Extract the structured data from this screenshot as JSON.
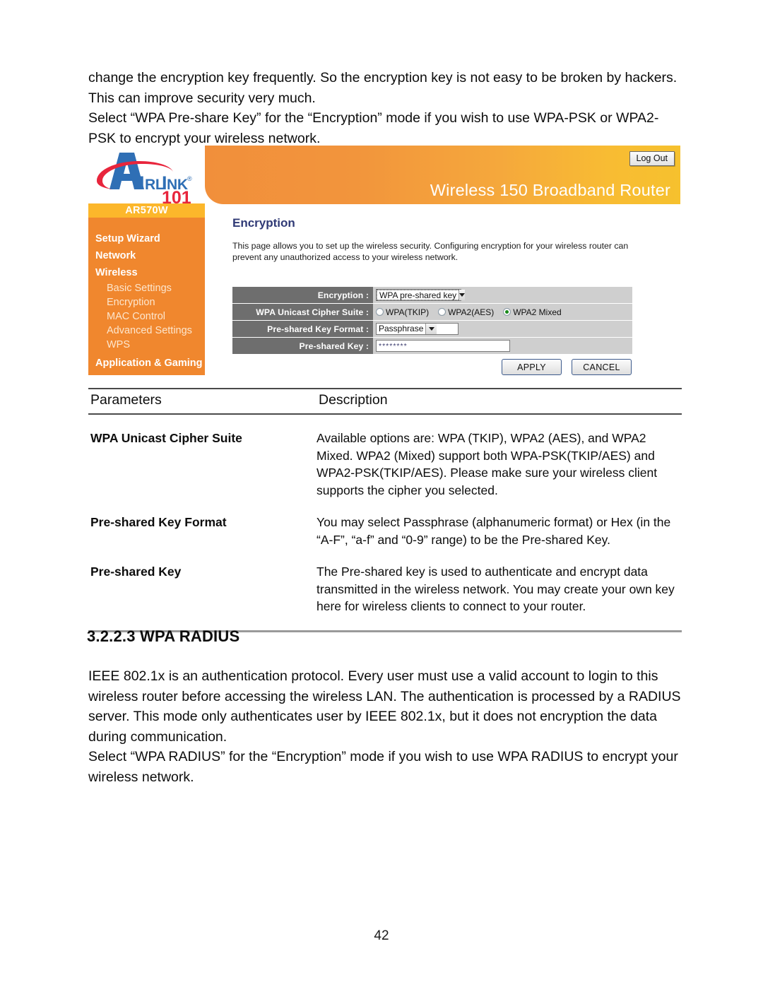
{
  "intro": {
    "paragraph_1": "change the encryption key frequently. So the encryption key is not easy to be broken by hackers. This can improve security very much.",
    "paragraph_2": "Select “WPA Pre-share Key” for the “Encryption” mode if you wish to use WPA-PSK or WPA2-PSK to encrypt your wireless network."
  },
  "router_ui": {
    "brand": {
      "name_a": "A",
      "name_rest": "IRLINK",
      "registered_mark": "®",
      "sub_number": "101"
    },
    "header": {
      "logout_label": "Log Out",
      "title": "Wireless 150 Broadband Router",
      "gradient_start": "#f18f3b",
      "gradient_end": "#f6c12e"
    },
    "sidebar": {
      "model": "AR570W",
      "model_bar_color": "#fcb72b",
      "background_color": "#f0872e",
      "items": [
        {
          "label": "Setup Wizard",
          "level": "top"
        },
        {
          "label": "Network",
          "level": "top"
        },
        {
          "label": "Wireless",
          "level": "top"
        },
        {
          "label": "Basic Settings",
          "level": "sub"
        },
        {
          "label": "Encryption",
          "level": "sub"
        },
        {
          "label": "MAC Control",
          "level": "sub"
        },
        {
          "label": "Advanced Settings",
          "level": "sub"
        },
        {
          "label": "WPS",
          "level": "sub"
        },
        {
          "label": "Application & Gaming",
          "level": "top"
        }
      ]
    },
    "content": {
      "title": "Encryption",
      "title_color": "#303a76",
      "description": "This page allows you to set up the wireless security. Configuring encryption for your wireless router can prevent any unauthorized access to your wireless network."
    },
    "form": {
      "encryption": {
        "label": "Encryption :",
        "value": "WPA pre-shared key"
      },
      "cipher_suite": {
        "label": "WPA Unicast Cipher Suite :",
        "options": [
          {
            "label": "WPA(TKIP)",
            "selected": false
          },
          {
            "label": "WPA2(AES)",
            "selected": false
          },
          {
            "label": "WPA2 Mixed",
            "selected": true
          }
        ],
        "selected_color": "#1a8a1a"
      },
      "key_format": {
        "label": "Pre-shared Key Format :",
        "value": "Passphrase"
      },
      "pre_shared_key": {
        "label": "Pre-shared Key :",
        "value": "********"
      },
      "apply_label": "APPLY",
      "cancel_label": "CANCEL"
    }
  },
  "param_table": {
    "headers": {
      "col1": "Parameters",
      "col2": "Description"
    },
    "rows": [
      {
        "parameter": "WPA Unicast Cipher Suite",
        "description": "Available options are: WPA (TKIP), WPA2 (AES), and WPA2 Mixed. WPA2 (Mixed) support both WPA-PSK(TKIP/AES) and WPA2-PSK(TKIP/AES). Please make sure your wireless client supports the cipher you selected."
      },
      {
        "parameter": "Pre-shared Key Format",
        "description": "You may select Passphrase (alphanumeric format) or Hex (in the “A-F”, “a-f” and “0-9” range) to be the Pre-shared Key."
      },
      {
        "parameter": "Pre-shared Key",
        "description": "The Pre-shared key is used to authenticate and encrypt data transmitted in the wireless network. You may create your own key here for wireless clients to connect to your router."
      }
    ]
  },
  "section": {
    "heading": "3.2.2.3 WPA RADIUS",
    "paragraph_1": "IEEE 802.1x is an authentication protocol. Every user must use a valid account to login to this wireless router before accessing the wireless LAN. The authentication is processed by a RADIUS server. This mode only authenticates user by IEEE 802.1x, but it does not encryption the data during communication.",
    "paragraph_2": "Select “WPA RADIUS” for the “Encryption” mode if you wish to use WPA RADIUS to encrypt your wireless network."
  },
  "footer": {
    "page_number": "42"
  }
}
